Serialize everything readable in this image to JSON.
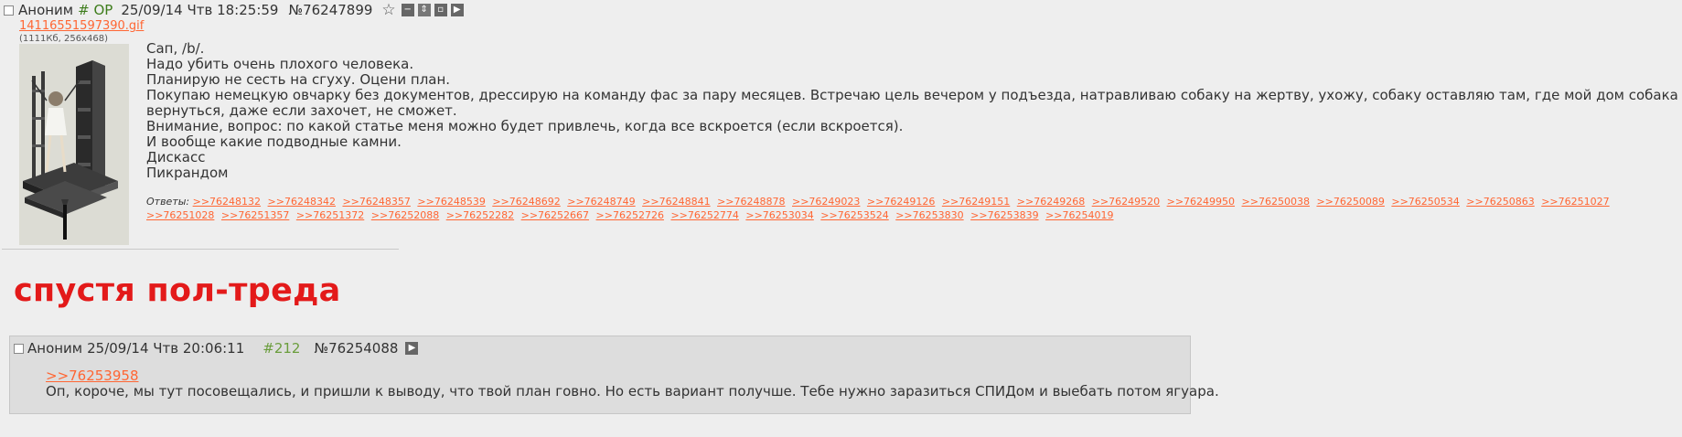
{
  "op": {
    "name": "Аноним",
    "trip": "# OP",
    "date": "25/09/14 Чтв 18:25:59",
    "number": "№76247899",
    "icons": [
      "star-icon",
      "hide-icon",
      "expand-icon",
      "report-icon",
      "play-icon"
    ],
    "file": {
      "name": "14116551597390.gif",
      "meta": "(1111Кб, 256x468)"
    },
    "text": [
      "Сап, /b/.",
      "Надо убить очень плохого человека.",
      "Планирую не сесть на сгуху. Оцени план.",
      "Покупаю немецкую овчарку без документов, дрессирую на команду фас за пару месяцев. Встречаю цель вечером у подъезда, натравливаю собаку на жертву, ухожу, собаку оставляю там, где мой дом собака не знает,",
      "вернуться, даже если захочет, не сможет.",
      "Внимание, вопрос: по какой статье меня можно будет привлечь, когда все вскроется (если вскроется).",
      "И вообще какие подводные камни.",
      "Дискасс",
      "Пикрандом"
    ],
    "replies_label": "Ответы:",
    "replies": [
      ">>76248132",
      ">>76248342",
      ">>76248357",
      ">>76248539",
      ">>76248692",
      ">>76248749",
      ">>76248841",
      ">>76248878",
      ">>76249023",
      ">>76249126",
      ">>76249151",
      ">>76249268",
      ">>76249520",
      ">>76249950",
      ">>76250038",
      ">>76250089",
      ">>76250534",
      ">>76250863",
      ">>76251027",
      ">>76251028",
      ">>76251357",
      ">>76251372",
      ">>76252088",
      ">>76252282",
      ">>76252667",
      ">>76252726",
      ">>76252774",
      ">>76253034",
      ">>76253524",
      ">>76253830",
      ">>76253839",
      ">>76254019"
    ]
  },
  "caption": "спустя пол-треда",
  "reply": {
    "name": "Аноним",
    "date": "25/09/14 Чтв 20:06:11",
    "count": "#212",
    "number": "№76254088",
    "ref": ">>76253958",
    "text": "Оп, короче, мы тут посовещались, и пришли к выводу, что твой план говно. Но есть вариант получше. Тебе нужно заразиться СПИДом и выебать потом ягуара."
  },
  "colors": {
    "link": "#ff6633",
    "trip": "#3e7d1c",
    "caption": "#e31a1a",
    "background": "#eeeeee",
    "reply_bg": "#dddddd"
  }
}
